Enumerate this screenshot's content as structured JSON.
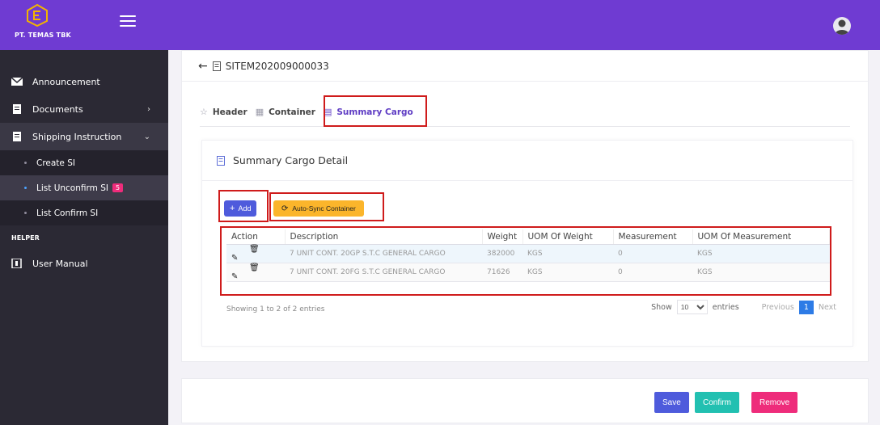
{
  "brand": {
    "name": "PT. TEMAS TBK"
  },
  "sidebar": {
    "items": [
      {
        "label": "Announcement",
        "icon": "envelope-icon"
      },
      {
        "label": "Documents",
        "icon": "document-icon"
      },
      {
        "label": "Shipping Instruction",
        "icon": "document-icon"
      }
    ],
    "sub_items": [
      {
        "label": "Create SI"
      },
      {
        "label": "List Unconfirm SI",
        "badge": "5"
      },
      {
        "label": "List Confirm SI"
      }
    ],
    "helper_title": "HELPER",
    "helper_items": [
      {
        "label": "User Manual",
        "icon": "book-icon"
      }
    ]
  },
  "page": {
    "doc_id": "SITEM202009000033"
  },
  "tabs": [
    {
      "label": "Header",
      "icon": "star-icon"
    },
    {
      "label": "Container",
      "icon": "grid-icon"
    },
    {
      "label": "Summary Cargo",
      "icon": "table-icon"
    }
  ],
  "section": {
    "title": "Summary Cargo Detail"
  },
  "buttons": {
    "add": "Add",
    "sync": "Auto-Sync Container"
  },
  "table": {
    "headers": [
      "Action",
      "Description",
      "Weight",
      "UOM Of Weight",
      "Measurement",
      "UOM Of Measurement"
    ],
    "rows": [
      {
        "description": "7 UNIT CONT. 20GP S.T.C GENERAL CARGO",
        "weight": "382000",
        "uom_weight": "KGS",
        "measurement": "0",
        "uom_measurement": "KGS"
      },
      {
        "description": "7 UNIT CONT. 20FG S.T.C GENERAL CARGO",
        "weight": "71626",
        "uom_weight": "KGS",
        "measurement": "0",
        "uom_measurement": "KGS"
      }
    ]
  },
  "pagination": {
    "showing": "Showing 1 to 2 of 2 entries",
    "show_label": "Show",
    "page_size": "10",
    "entries_label": "entries",
    "previous": "Previous",
    "current": "1",
    "next": "Next"
  },
  "actions": {
    "save": "Save",
    "confirm": "Confirm",
    "remove": "Remove"
  },
  "colors": {
    "topbar": "#6f3bd2",
    "sidebar": "#2b2934",
    "add": "#4e5bdc",
    "sync": "#fbb52b",
    "confirm": "#22c0b1",
    "remove": "#ee2c7b",
    "highlight": "#cf1b1b"
  }
}
